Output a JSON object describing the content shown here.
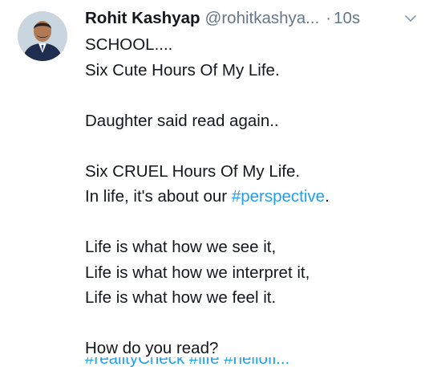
{
  "tweet": {
    "author_name": "Rohit Kashyap",
    "author_handle": "@rohitkashya...",
    "separator": "·",
    "timestamp": "10s",
    "lines": {
      "l1": "SCHOOL....",
      "l2": "Six Cute Hours Of My Life.",
      "l3": "Daughter said read again..",
      "l4": "Six CRUEL Hours Of My Life.",
      "l5_prefix": "In life, it's about our ",
      "l5_hashtag": "#perspective",
      "l5_suffix": ".",
      "l6": "Life is what how we see it,",
      "l7": "Life is what how we interpret it,",
      "l8": "Life is what how we feel it.",
      "l9": "How do you read?",
      "l10_hashtags": "#realityCheck #life #hellofi..."
    }
  },
  "colors": {
    "text": "#14171a",
    "muted": "#657786",
    "link": "#1da1f2"
  },
  "icons": {
    "menu": "chevron-down-icon",
    "avatar": "user-avatar"
  }
}
